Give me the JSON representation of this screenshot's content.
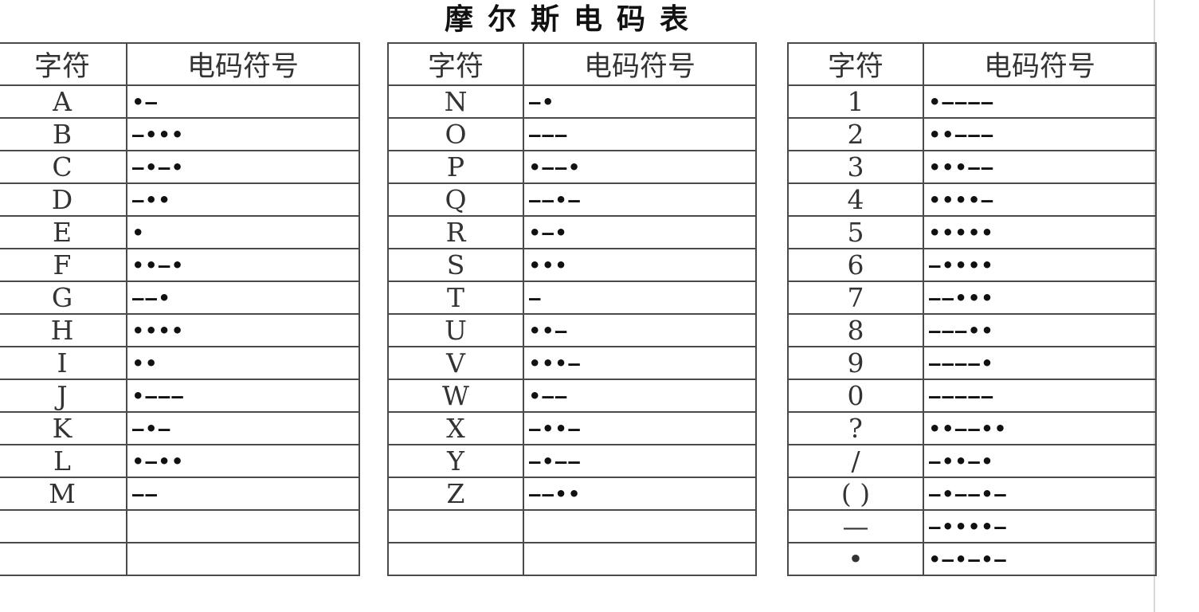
{
  "title": "摩尔斯电码表",
  "headers": {
    "char": "字符",
    "code": "电码符号"
  },
  "columns": [
    {
      "rows": [
        {
          "char": "A",
          "code": "•—"
        },
        {
          "char": "B",
          "code": "—•••"
        },
        {
          "char": "C",
          "code": "—•—•"
        },
        {
          "char": "D",
          "code": "—••"
        },
        {
          "char": "E",
          "code": "•"
        },
        {
          "char": "F",
          "code": "••—•"
        },
        {
          "char": "G",
          "code": "——•"
        },
        {
          "char": "H",
          "code": "••••"
        },
        {
          "char": "I",
          "code": "••"
        },
        {
          "char": "J",
          "code": "•———"
        },
        {
          "char": "K",
          "code": "—•—"
        },
        {
          "char": "L",
          "code": "•—••"
        },
        {
          "char": "M",
          "code": "——"
        },
        {
          "char": "",
          "code": ""
        },
        {
          "char": "",
          "code": ""
        }
      ]
    },
    {
      "rows": [
        {
          "char": "N",
          "code": "—•"
        },
        {
          "char": "O",
          "code": "———"
        },
        {
          "char": "P",
          "code": "•——•"
        },
        {
          "char": "Q",
          "code": "——•—"
        },
        {
          "char": "R",
          "code": "•—•"
        },
        {
          "char": "S",
          "code": "•••"
        },
        {
          "char": "T",
          "code": "—"
        },
        {
          "char": "U",
          "code": "••—"
        },
        {
          "char": "V",
          "code": "•••—"
        },
        {
          "char": "W",
          "code": "•——"
        },
        {
          "char": "X",
          "code": "—••—"
        },
        {
          "char": "Y",
          "code": "—•——"
        },
        {
          "char": "Z",
          "code": "——••"
        },
        {
          "char": "",
          "code": ""
        },
        {
          "char": "",
          "code": ""
        }
      ]
    },
    {
      "rows": [
        {
          "char": "1",
          "code": "•————"
        },
        {
          "char": "2",
          "code": "••———"
        },
        {
          "char": "3",
          "code": "•••——"
        },
        {
          "char": "4",
          "code": "••••—"
        },
        {
          "char": "5",
          "code": "•••••"
        },
        {
          "char": "6",
          "code": "—••••"
        },
        {
          "char": "7",
          "code": "——•••"
        },
        {
          "char": "8",
          "code": "———••"
        },
        {
          "char": "9",
          "code": "————•"
        },
        {
          "char": "0",
          "code": "—————"
        },
        {
          "char": "?",
          "code": "••——••"
        },
        {
          "char": "/",
          "code": "—••—•"
        },
        {
          "char": "( )",
          "code": "—•——•—"
        },
        {
          "char": "—",
          "code": "—••••—"
        },
        {
          "char": "•",
          "code": "•—•—•—"
        }
      ]
    }
  ]
}
